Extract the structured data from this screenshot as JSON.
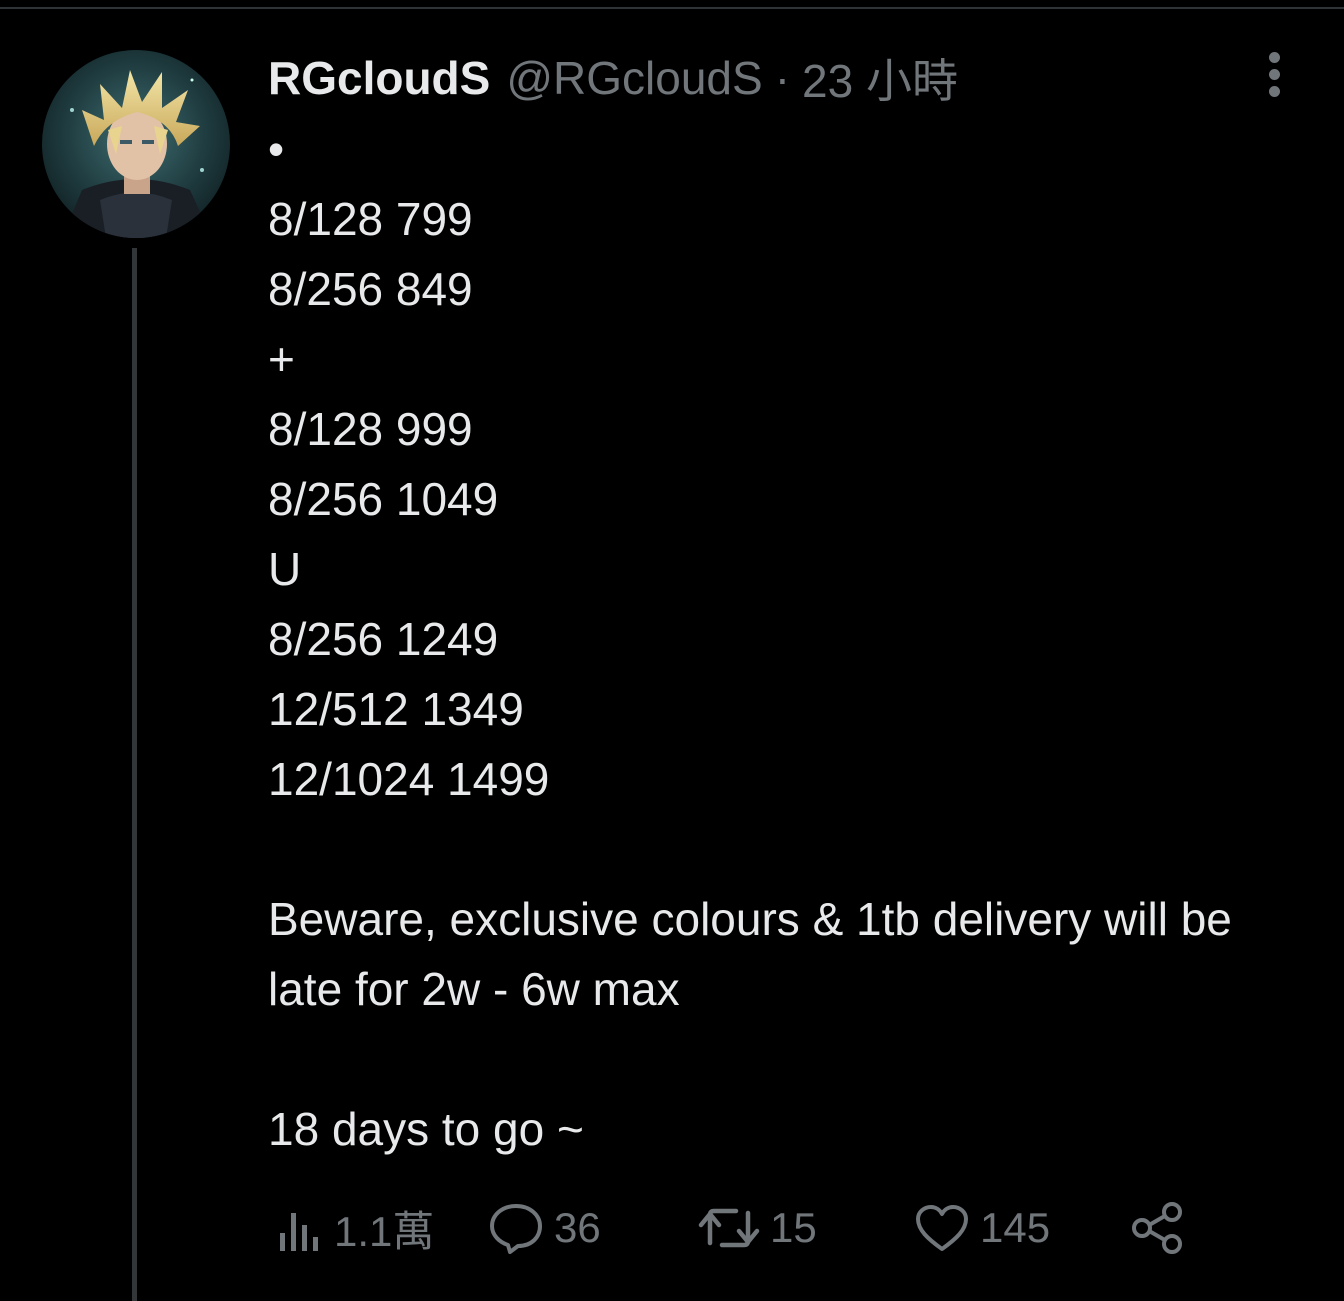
{
  "tweet": {
    "author": {
      "display_name": "RGcloudS",
      "handle": "@RGcloudS",
      "avatar_icon": "avatar-image-icon"
    },
    "separator": "·",
    "time": "23 小時",
    "body_lines": [
      "•",
      "8/128 799",
      "8/256 849",
      "+",
      "8/128 999",
      "8/256 1049",
      "U",
      "8/256 1249",
      "12/512 1349",
      "12/1024 1499"
    ],
    "paragraph": "Beware, exclusive colours & 1tb delivery will be late for 2w - 6w max",
    "closing": "18 days to go ~",
    "stats": {
      "views": "1.1萬",
      "replies": "36",
      "retweets": "15",
      "likes": "145"
    }
  },
  "colors": {
    "background": "#000000",
    "text": "#e7e9ea",
    "muted": "#71767b",
    "thread_line": "#333639"
  },
  "icons": {
    "views": "bar-chart-icon",
    "reply": "speech-bubble-icon",
    "retweet": "retweet-arrows-icon",
    "like": "heart-icon",
    "share": "share-nodes-icon",
    "more": "more-vertical-icon"
  }
}
